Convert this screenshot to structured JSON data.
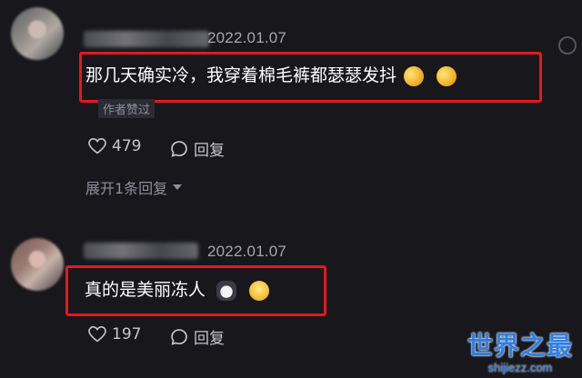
{
  "comments": [
    {
      "date": "2022.01.07",
      "text": "那几天确实冷，我穿着棉毛裤都瑟瑟发抖",
      "emojis": [
        "rofl-emoji",
        "rofl-emoji"
      ],
      "author_tag": "作者赞过",
      "likes": "479",
      "reply_label": "回复",
      "expand_label": "展开1条回复"
    },
    {
      "date": "2022.01.07",
      "text": "真的是美丽冻人",
      "emojis": [
        "cat-emoji",
        "pleading-emoji"
      ],
      "likes": "197",
      "reply_label": "回复"
    }
  ],
  "watermark": {
    "title": "世界之最",
    "url": "shijiezz.com"
  },
  "colors": {
    "background": "#17171c",
    "highlight": "#e8161a",
    "watermark": "#2e7fe8"
  }
}
